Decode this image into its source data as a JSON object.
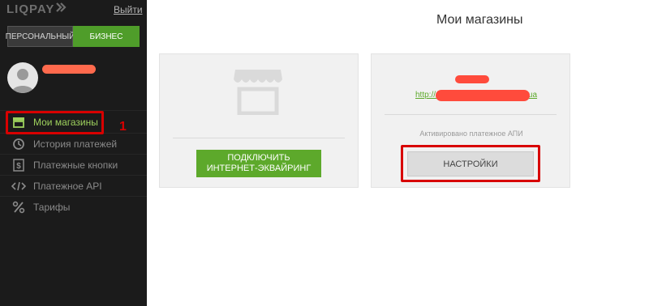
{
  "brand": {
    "name": "LIQPAY"
  },
  "header": {
    "logout_label": "Выйти",
    "page_title": "Мои магазины"
  },
  "mode_switch": {
    "personal_label": "ПЕРСОНАЛЬНЫЙ",
    "business_label": "БИЗНЕС"
  },
  "sidebar": {
    "items": [
      {
        "label": "Мои магазины",
        "icon": "store-icon",
        "active": true
      },
      {
        "label": "История платежей",
        "icon": "history-icon"
      },
      {
        "label": "Платежные кнопки",
        "icon": "dollar-icon"
      },
      {
        "label": "Платежное API",
        "icon": "code-icon"
      },
      {
        "label": "Тарифы",
        "icon": "percent-icon"
      }
    ],
    "marker_number": "1"
  },
  "cards": {
    "add_shop": {
      "button_label": "ПОДКЛЮЧИТЬ\nИНТЕРНЕТ-ЭКВАЙРИНГ"
    },
    "shop": {
      "url_prefix": "http://",
      "url_suffix": "...ua",
      "api_status": "Активировано платежное АПИ",
      "settings_label": "НАСТРОЙКИ"
    }
  },
  "colors": {
    "sidebar_bg": "#1b1b1b",
    "accent_green": "#5da92b",
    "highlight_red": "#d80000",
    "redaction": "#ff6a4d"
  }
}
